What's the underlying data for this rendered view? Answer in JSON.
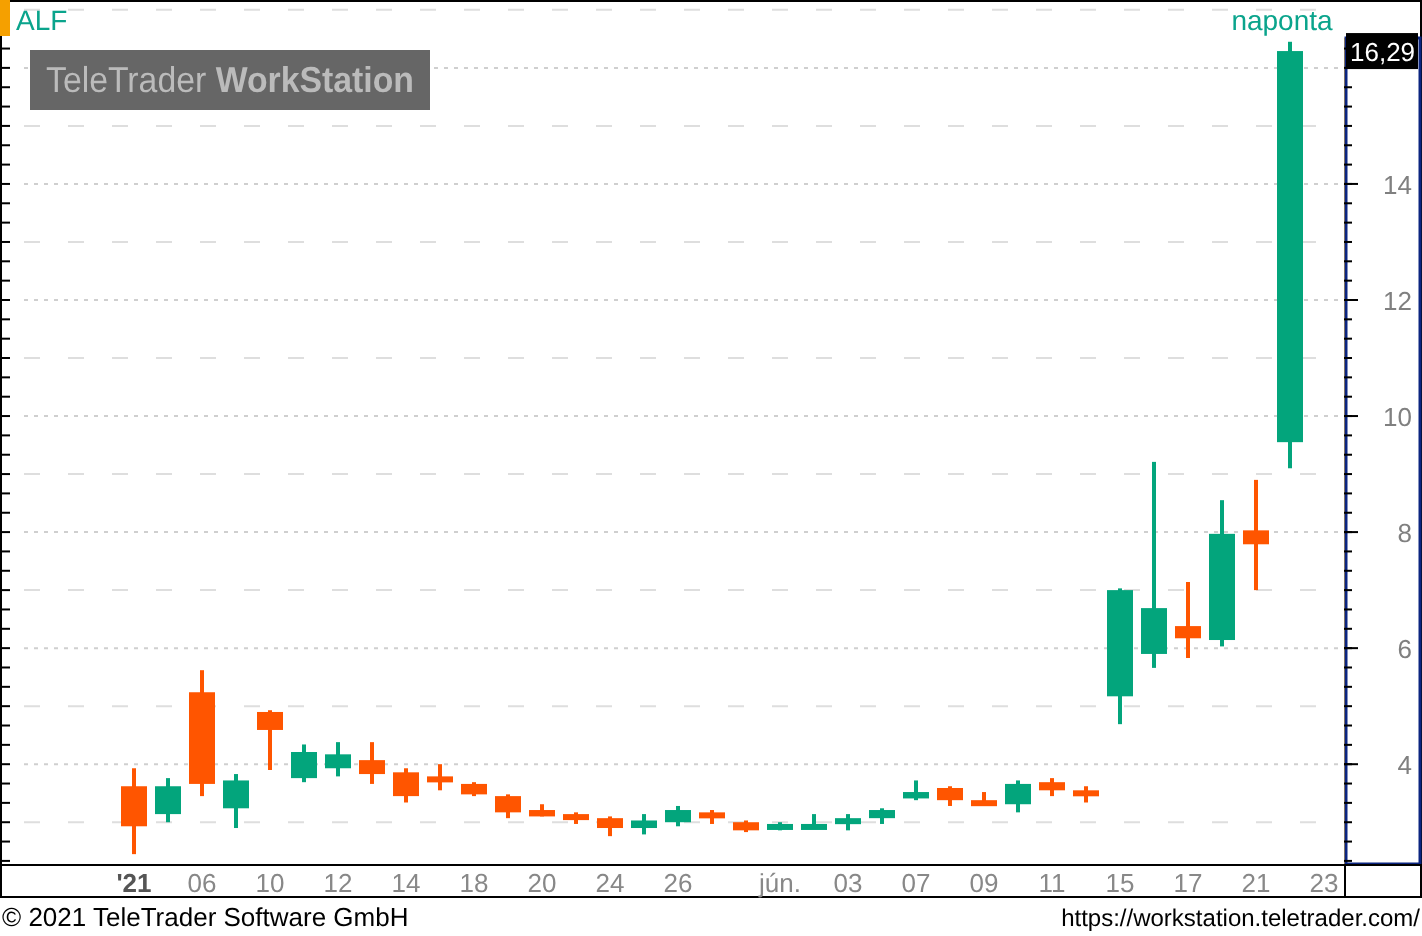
{
  "chart": {
    "symbol": "ALF",
    "interval": "naponta",
    "logo": {
      "light": "TeleTrader",
      "bold": "WorkStation"
    },
    "last_price_label": "16,29",
    "chart_data": {
      "type": "candlestick",
      "ylim": [
        2.28,
        17.17
      ],
      "yticks": [
        4,
        6,
        8,
        10,
        12,
        14
      ],
      "grid": true,
      "categories": [
        "'21",
        null,
        "06",
        null,
        "10",
        null,
        "12",
        null,
        "14",
        null,
        "18",
        null,
        "20",
        null,
        "24",
        null,
        "26",
        null,
        null,
        "jún.",
        null,
        "03",
        null,
        "07",
        null,
        "09",
        null,
        "11",
        null,
        "15",
        null,
        "17",
        null,
        "21",
        null,
        "23"
      ],
      "ohlc": [
        [
          3.62,
          3.93,
          2.45,
          2.93
        ],
        [
          3.14,
          3.76,
          3.0,
          3.62
        ],
        [
          5.24,
          5.62,
          3.45,
          3.66
        ],
        [
          3.24,
          3.83,
          2.9,
          3.72
        ],
        [
          4.9,
          4.93,
          3.9,
          4.59
        ],
        [
          3.76,
          4.34,
          3.69,
          4.21
        ],
        [
          3.93,
          4.38,
          3.79,
          4.17
        ],
        [
          4.07,
          4.38,
          3.66,
          3.83
        ],
        [
          3.86,
          3.93,
          3.34,
          3.45
        ],
        [
          3.79,
          4.0,
          3.55,
          3.69
        ],
        [
          3.66,
          3.69,
          3.45,
          3.48
        ],
        [
          3.45,
          3.48,
          3.07,
          3.17
        ],
        [
          3.21,
          3.31,
          3.1,
          3.1
        ],
        [
          3.14,
          3.17,
          2.97,
          3.07
        ],
        [
          3.07,
          3.1,
          2.76,
          2.9
        ],
        [
          2.9,
          3.14,
          2.79,
          3.03
        ],
        [
          3.0,
          3.28,
          2.93,
          3.21
        ],
        [
          3.17,
          3.21,
          2.97,
          3.07
        ],
        [
          3.0,
          3.03,
          2.83,
          2.86
        ],
        [
          2.9,
          3.0,
          2.86,
          2.97
        ],
        [
          2.9,
          3.14,
          2.9,
          2.97
        ],
        [
          3.0,
          3.14,
          2.86,
          3.07
        ],
        [
          3.07,
          3.24,
          2.97,
          3.21
        ],
        [
          3.41,
          3.72,
          3.38,
          3.52
        ],
        [
          3.59,
          3.62,
          3.28,
          3.38
        ],
        [
          3.38,
          3.52,
          3.28,
          3.28
        ],
        [
          3.31,
          3.72,
          3.17,
          3.66
        ],
        [
          3.69,
          3.76,
          3.45,
          3.55
        ],
        [
          3.55,
          3.62,
          3.34,
          3.45
        ],
        [
          5.17,
          7.03,
          4.69,
          7.0
        ],
        [
          5.9,
          9.21,
          5.66,
          6.69
        ],
        [
          6.38,
          7.14,
          5.83,
          6.17
        ],
        [
          6.14,
          8.55,
          6.03,
          7.97
        ],
        [
          8.03,
          8.9,
          7.0,
          7.79
        ],
        [
          9.55,
          16.45,
          9.1,
          16.29
        ],
        null
      ]
    }
  },
  "footer": {
    "copyright": "© 2021 TeleTrader Software GmbH",
    "url": "https://workstation.teletrader.com/"
  }
}
